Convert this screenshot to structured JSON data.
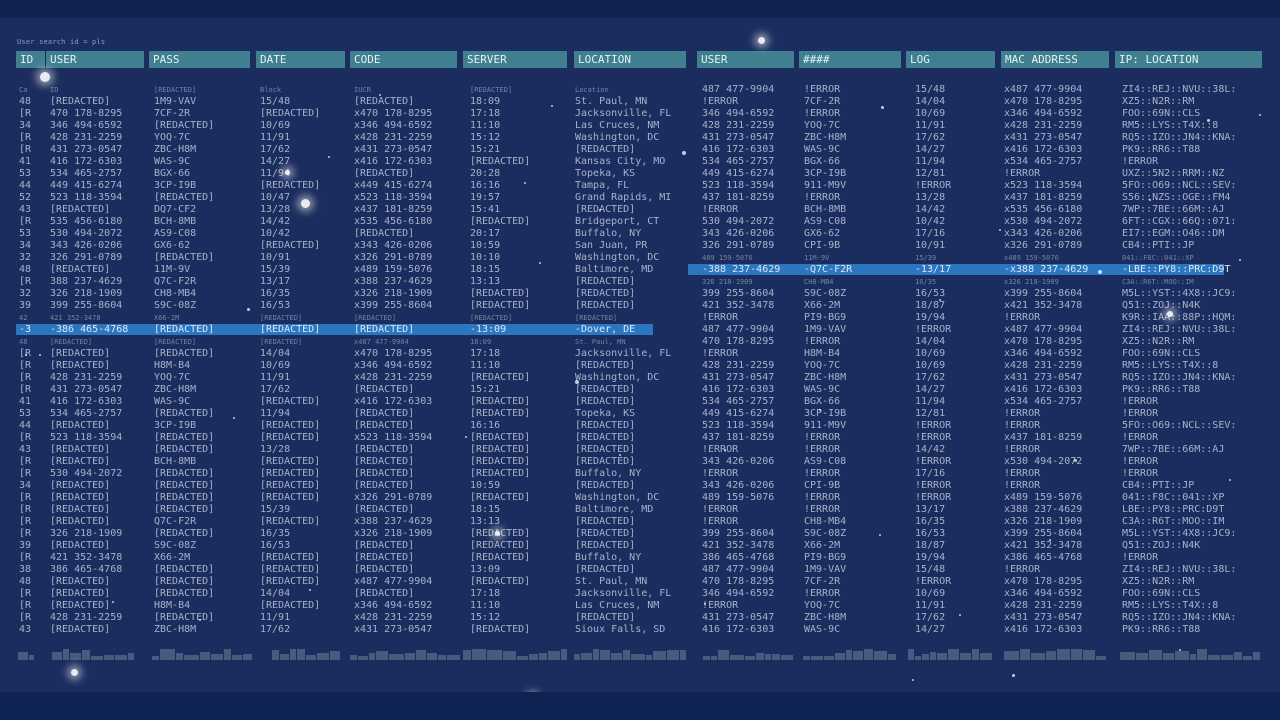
{
  "search_text": "User search id = pls",
  "left_headers": [
    "ID",
    "USER",
    "PASS",
    "DATE",
    "CODE",
    "SERVER",
    "LOCATION"
  ],
  "right_headers": [
    "USER",
    "####",
    "LOG",
    "MAC ADDRESS",
    "IP: LOCATION"
  ],
  "left_rows": [
    [
      "Ca",
      "ID",
      "[REDACTED]",
      "Block",
      "IUCR",
      "[REDACTED]",
      "Location"
    ],
    [
      "48",
      "[REDACTED]",
      "1M9-VAV",
      "15/48",
      "[REDACTED]",
      "18:09",
      "St. Paul, MN"
    ],
    [
      "[R",
      "470 178-8295",
      "7CF-2R",
      "[REDACTED]",
      "x470 178-8295",
      "17:18",
      "Jacksonville, FL"
    ],
    [
      "34",
      "346 494-6592",
      "[REDACTED]",
      "10/69",
      "x346 494-6592",
      "11:10",
      "Las Cruces, NM"
    ],
    [
      "[R",
      "428 231-2259",
      "YOQ-7C",
      "11/91",
      "x428 231-2259",
      "15:12",
      "Washington, DC"
    ],
    [
      "[R",
      "431 273-0547",
      "ZBC-H8M",
      "17/62",
      "x431 273-0547",
      "15:21",
      "[REDACTED]"
    ],
    [
      "41",
      "416 172-6303",
      "WAS-9C",
      "14/27",
      "x416 172-6303",
      "[REDACTED]",
      "Kansas City, MO"
    ],
    [
      "53",
      "534 465-2757",
      "BGX-66",
      "11/94",
      "[REDACTED]",
      "20:28",
      "Topeka, KS"
    ],
    [
      "44",
      "449 415-6274",
      "3CP-I9B",
      "[REDACTED]",
      "x449 415-6274",
      "16:16",
      "Tampa, FL"
    ],
    [
      "52",
      "523 118-3594",
      "[REDACTED]",
      "10/47",
      "x523 118-3594",
      "19:57",
      "Grand Rapids, MI"
    ],
    [
      "43",
      "[REDACTED]",
      "DQ7-CF2",
      "13/28",
      "x437 181-8259",
      "15:41",
      "[REDACTED]"
    ],
    [
      "[R",
      "535 456-6180",
      "BCH-8MB",
      "14/42",
      "x535 456-6180",
      "[REDACTED]",
      "Bridgeport, CT"
    ],
    [
      "53",
      "530 494-2072",
      "AS9-C08",
      "10/42",
      "[REDACTED]",
      "20:17",
      "Buffalo, NY"
    ],
    [
      "34",
      "343 426-0206",
      "GX6-62",
      "[REDACTED]",
      "x343 426-0206",
      "10:59",
      "San Juan, PR"
    ],
    [
      "32",
      "326 291-0789",
      "[REDACTED]",
      "10/91",
      "x326 291-0789",
      "10:10",
      "Washington, DC"
    ],
    [
      "48",
      "[REDACTED]",
      "11M-9V",
      "15/39",
      "x489 159-5076",
      "18:15",
      "Baltimore, MD"
    ],
    [
      "[R",
      "388 237-4629",
      "Q7C-F2R",
      "13/17",
      "x388 237-4629",
      "13:13",
      "[REDACTED]"
    ],
    [
      "32",
      "326 218-1909",
      "CH8-MB4",
      "16/35",
      "x326 218-1909",
      "[REDACTED]",
      "[REDACTED]"
    ],
    [
      "39",
      "399 255-8604",
      "S9C-08Z",
      "16/53",
      "x399 255-8604",
      "[REDACTED]",
      "[REDACTED]"
    ],
    [
      "42",
      "421 352-3478",
      "X66-2M",
      "[REDACTED]",
      "[REDACTED]",
      "[REDACTED]",
      "[REDACTED]"
    ],
    [
      "-3",
      "-386 465-4768",
      "[REDACTED]",
      "[REDACTED]",
      "[REDACTED]",
      "-13:09",
      "-Dover, DE"
    ],
    [
      "48",
      "[REDACTED]",
      "[REDACTED]",
      "[REDACTED]",
      "x487 477-9904",
      "18:09",
      "St. Paul, MN"
    ],
    [
      "[R",
      "[REDACTED]",
      "[REDACTED]",
      "14/04",
      "x470 178-8295",
      "17:18",
      "Jacksonville, FL"
    ],
    [
      "[R",
      "[REDACTED]",
      "H8M-B4",
      "10/69",
      "x346 494-6592",
      "11:10",
      "[REDACTED]"
    ],
    [
      "[R",
      "428 231-2259",
      "YOQ-7C",
      "11/91",
      "x428 231-2259",
      "[REDACTED]",
      "Washington, DC"
    ],
    [
      "[R",
      "431 273-0547",
      "ZBC-H8M",
      "17/62",
      "[REDACTED]",
      "15:21",
      "[REDACTED]"
    ],
    [
      "41",
      "416 172-6303",
      "WAS-9C",
      "[REDACTED]",
      "x416 172-6303",
      "[REDACTED]",
      "[REDACTED]"
    ],
    [
      "53",
      "534 465-2757",
      "[REDACTED]",
      "11/94",
      "[REDACTED]",
      "[REDACTED]",
      "Topeka, KS"
    ],
    [
      "44",
      "[REDACTED]",
      "3CP-I9B",
      "[REDACTED]",
      "[REDACTED]",
      "16:16",
      "[REDACTED]"
    ],
    [
      "[R",
      "523 118-3594",
      "[REDACTED]",
      "[REDACTED]",
      "x523 118-3594",
      "[REDACTED]",
      "[REDACTED]"
    ],
    [
      "43",
      "[REDACTED]",
      "[REDACTED]",
      "13/28",
      "[REDACTED]",
      "[REDACTED]",
      "[REDACTED]"
    ],
    [
      "[R",
      "[REDACTED]",
      "BCH-8MB",
      "[REDACTED]",
      "[REDACTED]",
      "[REDACTED]",
      "[REDACTED]"
    ],
    [
      "[R",
      "530 494-2072",
      "[REDACTED]",
      "[REDACTED]",
      "[REDACTED]",
      "[REDACTED]",
      "Buffalo, NY"
    ],
    [
      "34",
      "[REDACTED]",
      "[REDACTED]",
      "[REDACTED]",
      "[REDACTED]",
      "10:59",
      "[REDACTED]"
    ],
    [
      "[R",
      "[REDACTED]",
      "[REDACTED]",
      "[REDACTED]",
      "x326 291-0789",
      "[REDACTED]",
      "Washington, DC"
    ],
    [
      "[R",
      "[REDACTED]",
      "[REDACTED]",
      "15/39",
      "[REDACTED]",
      "18:15",
      "Baltimore, MD"
    ],
    [
      "[R",
      "[REDACTED]",
      "Q7C-F2R",
      "[REDACTED]",
      "x388 237-4629",
      "13:13",
      "[REDACTED]"
    ],
    [
      "[R",
      "326 218-1909",
      "[REDACTED]",
      "16/35",
      "x326 218-1909",
      "[REDACTED]",
      "[REDACTED]"
    ],
    [
      "39",
      "[REDACTED]",
      "S9C-08Z",
      "16/53",
      "[REDACTED]",
      "[REDACTED]",
      "[REDACTED]"
    ],
    [
      "[R",
      "421 352-3478",
      "X66-2M",
      "[REDACTED]",
      "[REDACTED]",
      "[REDACTED]",
      "Buffalo, NY"
    ],
    [
      "38",
      "386 465-4768",
      "[REDACTED]",
      "[REDACTED]",
      "[REDACTED]",
      "13:09",
      "[REDACTED]"
    ],
    [
      "48",
      "[REDACTED]",
      "[REDACTED]",
      "[REDACTED]",
      "x487 477-9904",
      "[REDACTED]",
      "St. Paul, MN"
    ],
    [
      "[R",
      "[REDACTED]",
      "[REDACTED]",
      "14/04",
      "[REDACTED]",
      "17:18",
      "Jacksonville, FL"
    ],
    [
      "[R",
      "[REDACTED]",
      "H8M-B4",
      "[REDACTED]",
      "x346 494-6592",
      "11:10",
      "Las Cruces, NM"
    ],
    [
      "[R",
      "428 231-2259",
      "[REDACTED]",
      "11/91",
      "x428 231-2259",
      "15:12",
      "[REDACTED]"
    ],
    [
      "43",
      "[REDACTED]",
      "ZBC-H8M",
      "17/62",
      "x431 273-0547",
      "[REDACTED]",
      "Sioux Falls, SD"
    ]
  ],
  "right_rows": [
    [
      "487 477-9904",
      "!ERROR",
      "15/48",
      "x487 477-9904",
      "ZI4::REJ::NVU::38L:"
    ],
    [
      "!ERROR",
      "7CF-2R",
      "14/04",
      "x470 178-8295",
      "XZ5::N2R::RM"
    ],
    [
      "346 494-6592",
      "!ERROR",
      "10/69",
      "x346 494-6592",
      "FOO::69N::CLS"
    ],
    [
      "428 231-2259",
      "YOQ-7C",
      "11/91",
      "x428 231-2259",
      "RM5::LYS::T4X::8"
    ],
    [
      "431 273-0547",
      "ZBC-H8M",
      "17/62",
      "x431 273-0547",
      "RQ5::IZO::JN4::KNA:"
    ],
    [
      "416 172-6303",
      "WAS-9C",
      "14/27",
      "x416 172-6303",
      "PK9::RR6::T88"
    ],
    [
      "534 465-2757",
      "BGX-66",
      "11/94",
      "x534 465-2757",
      "!ERROR"
    ],
    [
      "449 415-6274",
      "3CP-I9B",
      "12/81",
      "!ERROR",
      "UXZ::5N2::RRM::NZ"
    ],
    [
      "523 118-3594",
      "911-M9V",
      "!ERROR",
      "x523 118-3594",
      "5FO::O69::NCL::SEV:"
    ],
    [
      "437 181-8259",
      "!ERROR",
      "13/28",
      "x437 181-8259",
      "S56::NZS::OGE::FM4"
    ],
    [
      "!ERROR",
      "BCH-8MB",
      "14/42",
      "x535 456-6180",
      "7WP::7BE::66M::AJ"
    ],
    [
      "530 494-2072",
      "AS9-C08",
      "10/42",
      "x530 494-2072",
      "6FT::CGX::66Q::071:"
    ],
    [
      "343 426-0206",
      "GX6-62",
      "17/16",
      "x343 426-0206",
      "EI7::EGM::O46::DM"
    ],
    [
      "326 291-0789",
      "CPI-9B",
      "10/91",
      "x326 291-0789",
      "CB4::PTI::JP"
    ],
    [
      "489 159-5076",
      "11M-9V",
      "15/39",
      "x489 159-5076",
      "041::F8C::041::XP"
    ],
    [
      "-388 237-4629",
      "-Q7C-F2R",
      "-13/17",
      "-x388 237-4629",
      "-LBE::PY8::PRC:D9T"
    ],
    [
      "326 218-1909",
      "CH8-MB4",
      "16/35",
      "x326 218-1909",
      "C3A::R6T::MOO::IM"
    ],
    [
      "399 255-8604",
      "S9C-08Z",
      "16/53",
      "x399 255-8604",
      "M5L::YST::4X8::JC9:"
    ],
    [
      "421 352-3478",
      "X66-2M",
      "18/87",
      "x421 352-3478",
      "Q51::ZOJ::N4K"
    ],
    [
      "!ERROR",
      "PI9-BG9",
      "19/94",
      "!ERROR",
      "K9R::IAA::88P::HQM:"
    ],
    [
      "487 477-9904",
      "1M9-VAV",
      "!ERROR",
      "x487 477-9904",
      "ZI4::REJ::NVU::38L:"
    ],
    [
      "470 178-8295",
      "!ERROR",
      "14/04",
      "x470 178-8295",
      "XZ5::N2R::RM"
    ],
    [
      "!ERROR",
      "H8M-B4",
      "10/69",
      "x346 494-6592",
      "FOO::69N::CLS"
    ],
    [
      "428 231-2259",
      "YOQ-7C",
      "10/69",
      "x428 231-2259",
      "RM5::LYS::T4X::8"
    ],
    [
      "431 273-0547",
      "ZBC-H8M",
      "17/62",
      "x431 273-0547",
      "RQ5::IZO::JN4::KNA:"
    ],
    [
      "416 172-6303",
      "WAS-9C",
      "14/27",
      "x416 172-6303",
      "PK9::RR6::T88"
    ],
    [
      "534 465-2757",
      "BGX-66",
      "11/94",
      "x534 465-2757",
      "!ERROR"
    ],
    [
      "449 415-6274",
      "3CP-I9B",
      "12/81",
      "!ERROR",
      "!ERROR"
    ],
    [
      "523 118-3594",
      "911-M9V",
      "!ERROR",
      "!ERROR",
      "5FO::O69::NCL::SEV:"
    ],
    [
      "437 181-8259",
      "!ERROR",
      "!ERROR",
      "x437 181-8259",
      "!ERROR"
    ],
    [
      "!ERROR",
      "!ERROR",
      "14/42",
      "!ERROR",
      "7WP::7BE::66M::AJ"
    ],
    [
      "343 426-0206",
      "AS9-C08",
      "!ERROR",
      "x530 494-2072",
      "!ERROR"
    ],
    [
      "!ERROR",
      "!ERROR",
      "17/16",
      "!ERROR",
      "!ERROR"
    ],
    [
      "343 426-0206",
      "CPI-9B",
      "!ERROR",
      "!ERROR",
      "CB4::PTI::JP"
    ],
    [
      "489 159-5076",
      "!ERROR",
      "!ERROR",
      "x489 159-5076",
      "041::F8C::041::XP"
    ],
    [
      "!ERROR",
      "!ERROR",
      "13/17",
      "x388 237-4629",
      "LBE::PY8::PRC:D9T"
    ],
    [
      "!ERROR",
      "CH8-MB4",
      "16/35",
      "x326 218-1909",
      "C3A::R6T::MOO::IM"
    ],
    [
      "399 255-8604",
      "S9C-08Z",
      "16/53",
      "x399 255-8604",
      "M5L::YST::4X8::JC9:"
    ],
    [
      "421 352-3478",
      "X66-2M",
      "18/87",
      "x421 352-3478",
      "Q51::ZOJ::N4K"
    ],
    [
      "386 465-4768",
      "PI9-BG9",
      "19/94",
      "x386 465-4768",
      "!ERROR"
    ],
    [
      "487 477-9904",
      "1M9-VAV",
      "15/48",
      "!ERROR",
      "ZI4::REJ::NVU::38L:"
    ],
    [
      "470 178-8295",
      "7CF-2R",
      "!ERROR",
      "x470 178-8295",
      "XZ5::N2R::RM"
    ],
    [
      "346 494-6592",
      "!ERROR",
      "10/69",
      "x346 494-6592",
      "FOO::69N::CLS"
    ],
    [
      "!ERROR",
      "YOQ-7C",
      "11/91",
      "x428 231-2259",
      "RM5::LYS::T4X::8"
    ],
    [
      "431 273-0547",
      "ZBC-H8M",
      "17/62",
      "x431 273-0547",
      "RQ5::IZO::JN4::KNA:"
    ],
    [
      "416 172-6303",
      "WAS-9C",
      "14/27",
      "x416 172-6303",
      "PK9::RR6::T88"
    ]
  ],
  "left_dim_rows": [
    0,
    19,
    21
  ],
  "right_dim_rows": [
    14,
    16
  ],
  "left_highlight_row": 20,
  "right_highlight_row": 15
}
